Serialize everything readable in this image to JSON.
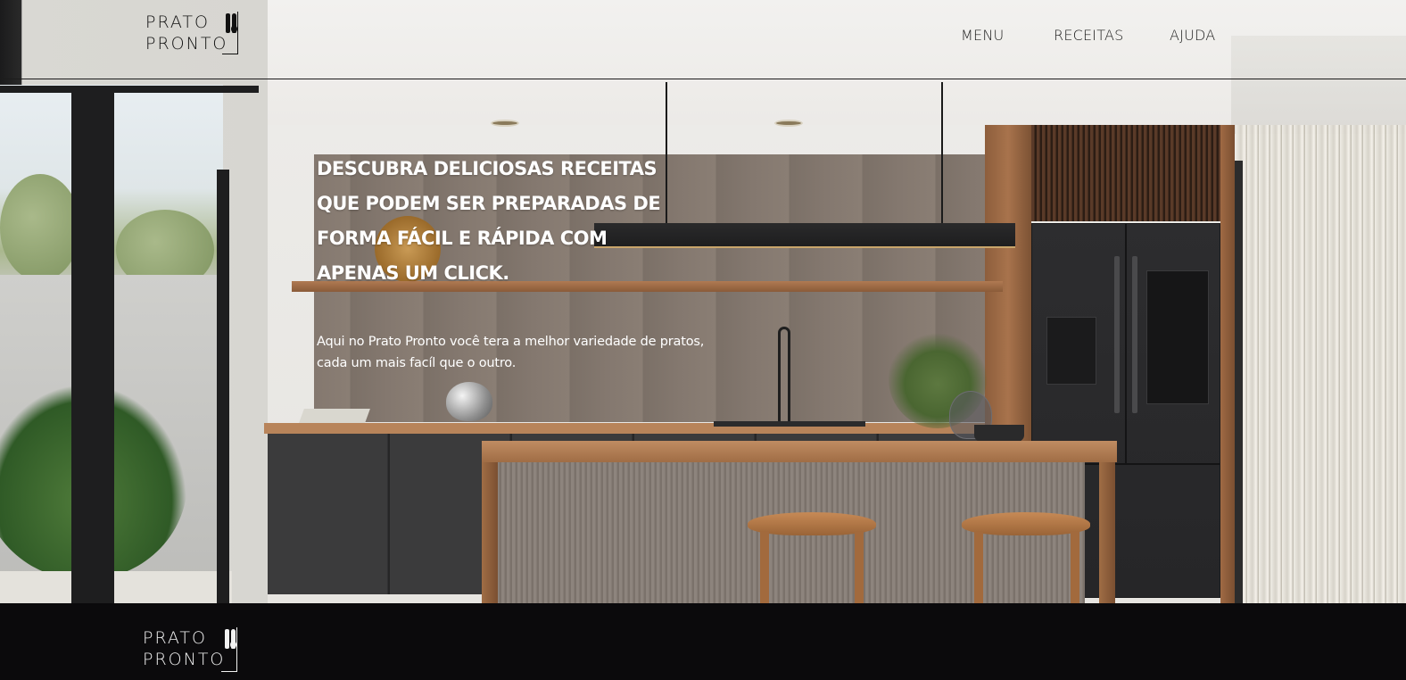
{
  "brand": {
    "line1": "PRATO",
    "line2": "PRONTO",
    "icon": "cutlery-icon"
  },
  "nav": {
    "items": [
      {
        "label": "MENU"
      },
      {
        "label": "RECEITAS"
      },
      {
        "label": "AJUDA"
      }
    ]
  },
  "hero": {
    "headline": "DESCUBRA DELICIOSAS RECEITAS QUE PODEM SER PREPARADAS DE FORMA FÁCIL E RÁPIDA COM APENAS UM CLICK.",
    "subtext": "Aqui no Prato Pronto você tera a melhor variedade de pratos, cada um mais facíl que o outro.",
    "background": "kitchen-interior-image"
  },
  "footer": {
    "brand_line1": "PRATO",
    "brand_line2": "PRONTO"
  },
  "colors": {
    "header_text": "#1c1c1c",
    "hero_text": "#ffffff",
    "footer_bg": "#0b0a0c",
    "footer_text": "#f2f2f2"
  }
}
